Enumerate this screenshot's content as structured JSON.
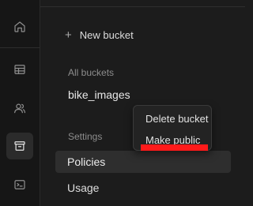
{
  "sidebar": {
    "icons": [
      {
        "name": "home-icon",
        "active": false
      },
      {
        "name": "table-icon",
        "active": false
      },
      {
        "name": "users-icon",
        "active": false
      },
      {
        "name": "storage-icon",
        "active": true
      },
      {
        "name": "terminal-icon",
        "active": false
      }
    ]
  },
  "panel": {
    "new_bucket_label": "New bucket",
    "new_bucket_icon": "plus-icon",
    "all_buckets_label": "All buckets",
    "buckets": [
      "bike_images"
    ],
    "settings_label": "Settings",
    "settings_items": [
      "Policies",
      "Usage"
    ],
    "selected_item": "Policies"
  },
  "context_menu": {
    "items": [
      "Delete bucket",
      "Make public"
    ]
  },
  "annotation": {
    "highlight_color": "#ff1a1a"
  }
}
